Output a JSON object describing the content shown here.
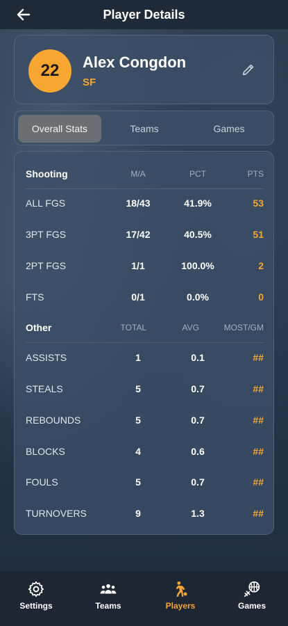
{
  "header": {
    "title": "Player Details"
  },
  "player": {
    "number": "22",
    "name": "Alex Congdon",
    "position": "SF"
  },
  "tabs": [
    {
      "label": "Overall Stats",
      "active": true
    },
    {
      "label": "Teams",
      "active": false
    },
    {
      "label": "Games",
      "active": false
    }
  ],
  "shooting": {
    "header": [
      "Shooting",
      "M/A",
      "PCT",
      "PTS"
    ],
    "rows": [
      [
        "ALL FGS",
        "18/43",
        "41.9%",
        "53"
      ],
      [
        "3PT FGS",
        "17/42",
        "40.5%",
        "51"
      ],
      [
        "2PT FGS",
        "1/1",
        "100.0%",
        "2"
      ],
      [
        "FTS",
        "0/1",
        "0.0%",
        "0"
      ]
    ]
  },
  "other": {
    "header": [
      "Other",
      "TOTAL",
      "AVG",
      "MOST/GM"
    ],
    "rows": [
      [
        "ASSISTS",
        "1",
        "0.1",
        "##"
      ],
      [
        "STEALS",
        "5",
        "0.7",
        "##"
      ],
      [
        "REBOUNDS",
        "5",
        "0.7",
        "##"
      ],
      [
        "BLOCKS",
        "4",
        "0.6",
        "##"
      ],
      [
        "FOULS",
        "5",
        "0.7",
        "##"
      ],
      [
        "TURNOVERS",
        "9",
        "1.3",
        "##"
      ]
    ]
  },
  "nav": [
    {
      "label": "Settings",
      "icon": "gear-icon",
      "active": false
    },
    {
      "label": "Teams",
      "icon": "group-icon",
      "active": false
    },
    {
      "label": "Players",
      "icon": "player-dribble-icon",
      "active": true
    },
    {
      "label": "Games",
      "icon": "basketball-icon",
      "active": false
    }
  ],
  "colors": {
    "accent": "#f7a631",
    "background": "#223042",
    "nav": "#1d2733"
  }
}
